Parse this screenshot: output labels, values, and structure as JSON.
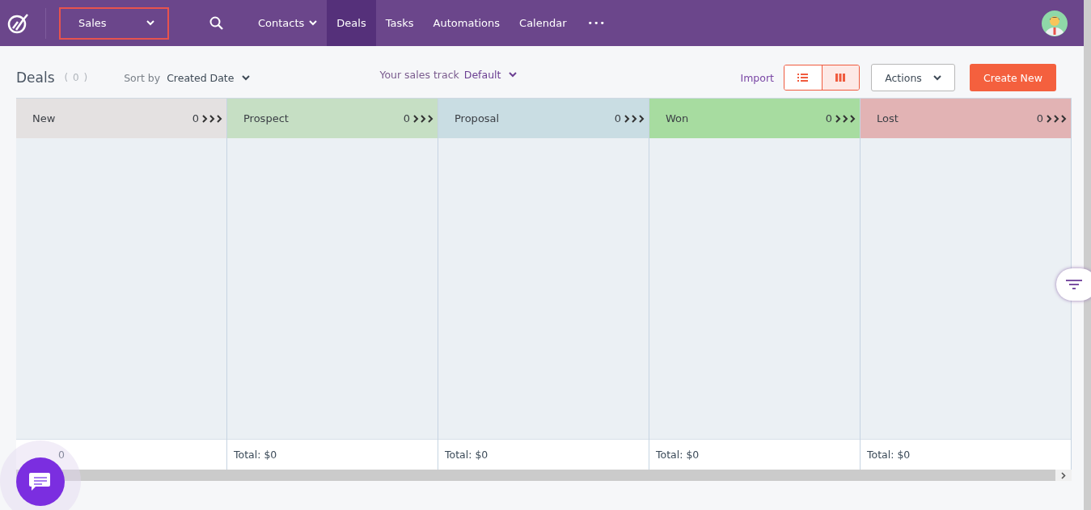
{
  "nav": {
    "pipeline": "Sales",
    "items": [
      {
        "label": "Contacts",
        "dropdown": true,
        "selected": false
      },
      {
        "label": "Deals",
        "dropdown": false,
        "selected": true
      },
      {
        "label": "Tasks",
        "dropdown": false,
        "selected": false
      },
      {
        "label": "Automations",
        "dropdown": false,
        "selected": false
      },
      {
        "label": "Calendar",
        "dropdown": false,
        "selected": false
      }
    ],
    "more": "•••"
  },
  "toolbar": {
    "title": "Deals",
    "count": "( 0 )",
    "sort_label": "Sort by",
    "sort_value": "Created Date",
    "track_label": "Your sales track",
    "track_value": "Default",
    "import": "Import",
    "views": [
      {
        "kind": "list",
        "selected": false
      },
      {
        "kind": "board",
        "selected": true
      }
    ],
    "actions": "Actions",
    "create": "Create New"
  },
  "columns": [
    {
      "name": "New",
      "count": "0",
      "color": "#e4e1e1",
      "total": "0"
    },
    {
      "name": "Prospect",
      "count": "0",
      "color": "#c6dfc4",
      "total": "Total: $0"
    },
    {
      "name": "Proposal",
      "count": "0",
      "color": "#c9dde3",
      "total": "Total: $0"
    },
    {
      "name": "Won",
      "count": "0",
      "color": "#a7dca0",
      "total": "Total: $0"
    },
    {
      "name": "Lost",
      "count": "0",
      "color": "#e2b3b4",
      "total": "Total: $0"
    }
  ]
}
